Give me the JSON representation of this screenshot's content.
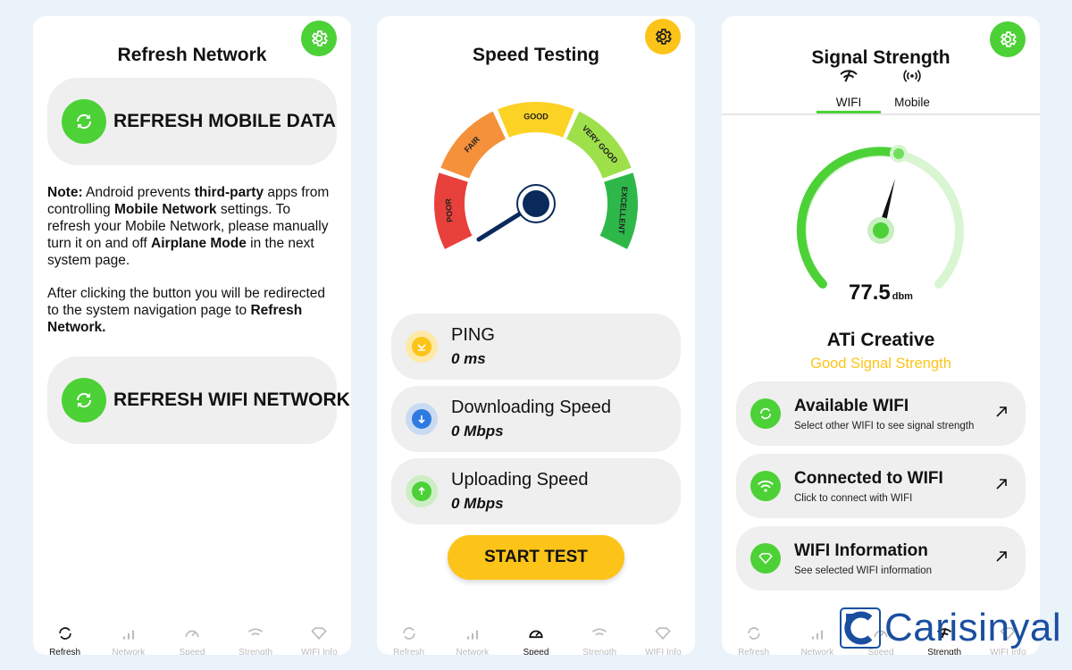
{
  "refresh": {
    "title": "Refresh Network",
    "mobile_button": "REFRESH MOBILE DATA",
    "wifi_button": "REFRESH WIFI NETWORK",
    "note_label": "Note:",
    "note_1": " Android prevents ",
    "note_2": "third-party",
    "note_3": " apps from controlling ",
    "note_4": "Mobile Network",
    "note_5": " settings. To refresh your Mobile Network, please manually turn it on and off ",
    "note_6": "Airplane Mode",
    "note_7": " in the next system page.",
    "note2_1": "After clicking the button you will be redirected to the system navigation page to ",
    "note2_2": "Refresh Network."
  },
  "nav": [
    "Refresh",
    "Network",
    "Speed",
    "Strength",
    "WIFI Info"
  ],
  "speed": {
    "title": "Speed Testing",
    "gauge_labels": [
      "POOR",
      "FAIR",
      "GOOD",
      "VERY GOOD",
      "EXCELLENT"
    ],
    "ping_label": "PING",
    "ping_value": "0 ms",
    "download_label": "Downloading Speed",
    "download_value": "0 Mbps",
    "upload_label": "Uploading Speed",
    "upload_value": "0 Mbps",
    "start_button": "START TEST"
  },
  "signal": {
    "title": "Signal Strength",
    "tab_wifi": "WIFI",
    "tab_mobile": "Mobile",
    "value": "77.5",
    "unit": "dbm",
    "network_name": "ATi Creative",
    "quality": "Good Signal Strength",
    "features": [
      {
        "title": "Available WIFI",
        "sub": "Select other WIFI to see signal strength"
      },
      {
        "title": "Connected to WIFI",
        "sub": "Click to connect with WIFI"
      },
      {
        "title": "WIFI Information",
        "sub": "See selected WIFI information"
      }
    ]
  },
  "watermark": "Carisinyal",
  "colors": {
    "green": "#4cd137",
    "yellow": "#fcc419",
    "blue": "#1a4fa0"
  }
}
